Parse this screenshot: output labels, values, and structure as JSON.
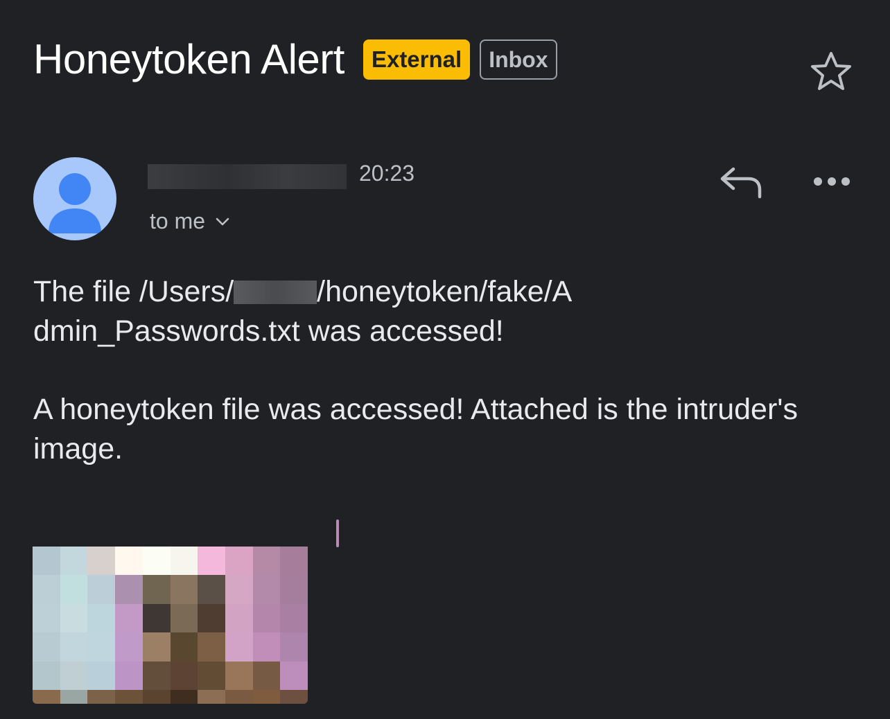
{
  "subject": "Honeytoken Alert",
  "labels": {
    "external": "External",
    "inbox": "Inbox"
  },
  "message": {
    "time": "20:23",
    "recipient": "to me",
    "body": {
      "p1_before": "The file /Users/",
      "p1_after_line1": "/honeytoken/fake/A",
      "p1_line2": "dmin_Passwords.txt was accessed!",
      "p2": "A honeytoken file was accessed! Attached is the intruder's image."
    }
  },
  "icons": {
    "star": "star-outline-icon",
    "reply": "reply-icon",
    "more": "more-horizontal-icon",
    "avatar": "person-icon",
    "expand": "chevron-down-icon"
  },
  "colors": {
    "background": "#202124",
    "external_chip": "#fbbc04",
    "avatar_bg": "#a8c7fa",
    "avatar_fg": "#4285f4"
  },
  "attachment_pixels": [
    "#b4c6cf",
    "#c3d8dc",
    "#d8d0cc",
    "#fff8ee",
    "#fcfef6",
    "#f6f6ee",
    "#f3b8dc",
    "#dba3c4",
    "#b48aa6",
    "#a67e9c",
    "#bccfd7",
    "#c2dfdf",
    "#bccfd9",
    "#ac90b0",
    "#706550",
    "#8a7560",
    "#5a5048",
    "#d6a7c4",
    "#b38aaa",
    "#a57d9d",
    "#bdd0d8",
    "#c9dde0",
    "#bdd5dd",
    "#c39ac6",
    "#3e3734",
    "#7b6a55",
    "#4e3d30",
    "#d3a3c3",
    "#b486ab",
    "#a97fa4",
    "#b8cad2",
    "#c1d6dd",
    "#c0d6de",
    "#c09ac8",
    "#9b8066",
    "#5a472f",
    "#7d5f46",
    "#d2a3c7",
    "#c18eba",
    "#ad85ad",
    "#b3c6cc",
    "#bfcfd3",
    "#b9cfd9",
    "#bc95c6",
    "#624e3a",
    "#5d4334",
    "#624c34",
    "#997659",
    "#765a44",
    "#bd8dbc",
    "#8a6a4c",
    "#9aa6a4",
    "#7c6248",
    "#6b5238",
    "#5a4430",
    "#3f2e20",
    "#8c6e54",
    "#7a5a40",
    "#7f5c3e",
    "#6e5040"
  ]
}
